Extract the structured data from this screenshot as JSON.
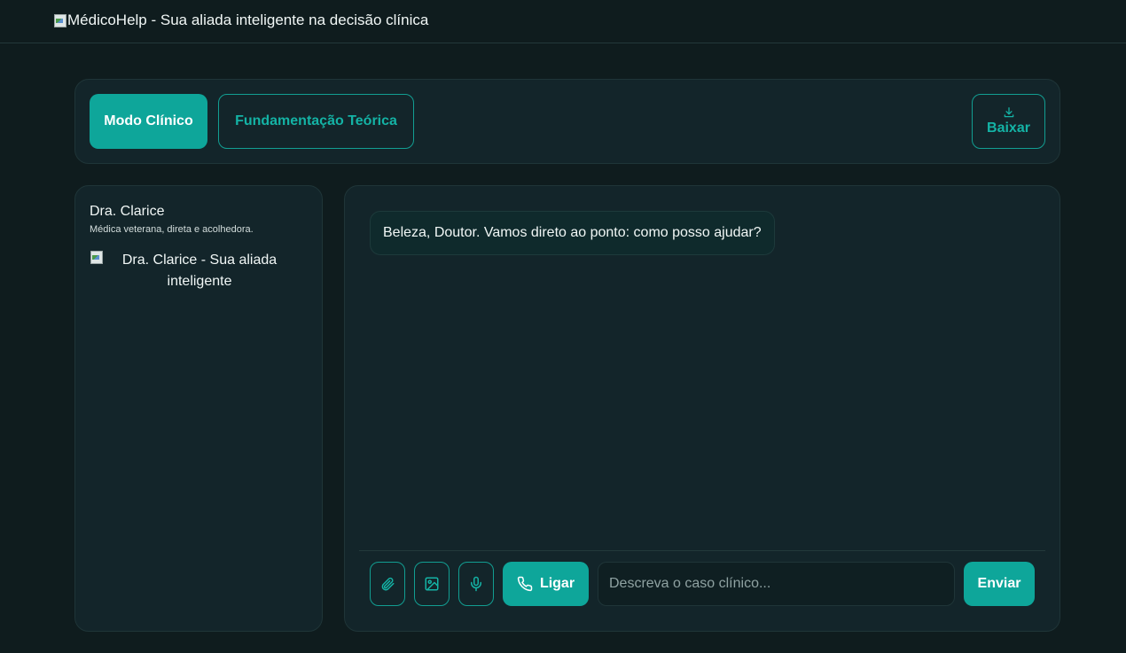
{
  "header": {
    "logo_alt": "MédicoHelp - Sua aliada inteligente na decisão clínica"
  },
  "modes": {
    "clinical_label": "Modo Clínico",
    "theory_label": "Fundamentação Teórica",
    "download_label": "Baixar"
  },
  "persona": {
    "name": "Dra. Clarice",
    "description": "Médica veterana, direta e acolhedora.",
    "image_alt": "Dra. Clarice - Sua aliada inteligente"
  },
  "chat": {
    "messages": [
      {
        "role": "assistant",
        "text": "Beleza, Doutor. Vamos direto ao ponto: como posso ajudar?"
      }
    ]
  },
  "composer": {
    "attach_icon": "paperclip-icon",
    "image_icon": "image-icon",
    "mic_icon": "microphone-icon",
    "call_label": "Ligar",
    "input_placeholder": "Descreva o caso clínico...",
    "input_value": "",
    "send_label": "Enviar"
  },
  "colors": {
    "background": "#0f1c1e",
    "panel": "#13252a",
    "accent": "#0ea69a",
    "accent_text": "#14b3a5"
  }
}
